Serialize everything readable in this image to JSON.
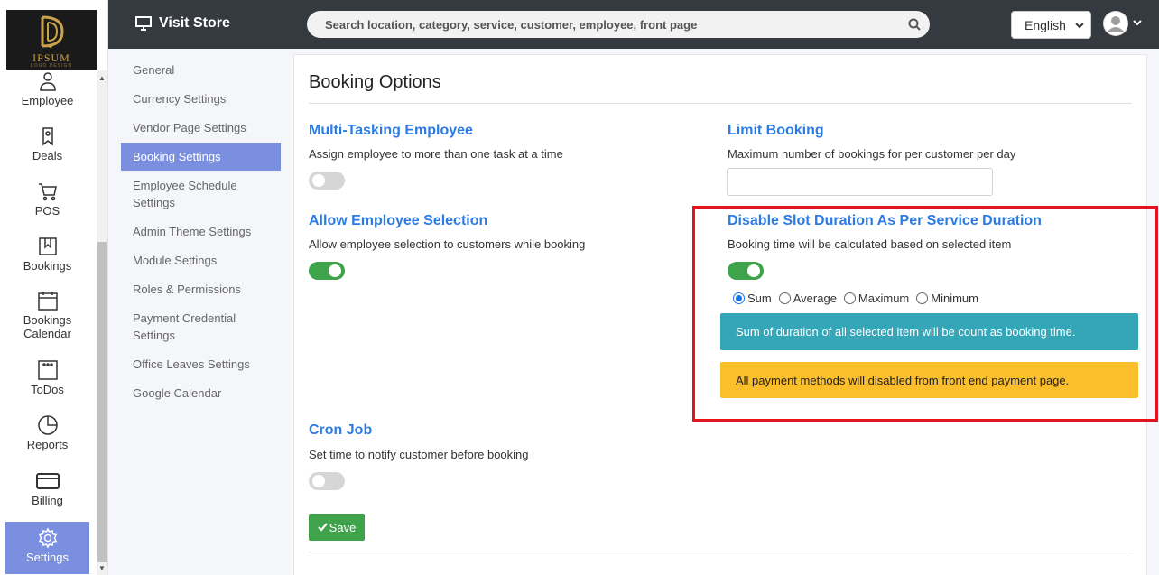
{
  "logo": {
    "brand": "IPSUM",
    "tagline": "LOGO DESIGN"
  },
  "rail": {
    "items": [
      {
        "label": "Employee",
        "icon": "employee-icon"
      },
      {
        "label": "Deals",
        "icon": "deals-icon"
      },
      {
        "label": "POS",
        "icon": "cart-icon"
      },
      {
        "label": "Bookings",
        "icon": "bookings-icon"
      },
      {
        "label": "Bookings Calendar",
        "icon": "calendar-icon"
      },
      {
        "label": "ToDos",
        "icon": "todos-icon"
      },
      {
        "label": "Reports",
        "icon": "pie-chart-icon"
      },
      {
        "label": "Billing",
        "icon": "credit-card-icon"
      },
      {
        "label": "Settings",
        "icon": "gear-icon",
        "active": true
      }
    ]
  },
  "topbar": {
    "visit_store": "Visit Store",
    "search_placeholder": "Search location, category, service, customer, employee, front page",
    "language": "English"
  },
  "submenu": {
    "items": [
      {
        "label": "General"
      },
      {
        "label": "Currency Settings"
      },
      {
        "label": "Vendor Page Settings"
      },
      {
        "label": "Booking Settings",
        "active": true
      },
      {
        "label": "Employee Schedule Settings"
      },
      {
        "label": "Admin Theme Settings"
      },
      {
        "label": "Module Settings"
      },
      {
        "label": "Roles & Permissions"
      },
      {
        "label": "Payment Credential Settings"
      },
      {
        "label": "Office Leaves Settings"
      },
      {
        "label": "Google Calendar"
      }
    ]
  },
  "main": {
    "title": "Booking Options",
    "multitask": {
      "title": "Multi-Tasking Employee",
      "desc": "Assign employee to more than one task at a time",
      "enabled": false
    },
    "limit": {
      "title": "Limit Booking",
      "desc": "Maximum number of bookings for per customer per day",
      "value": ""
    },
    "allow_selection": {
      "title": "Allow Employee Selection",
      "desc": "Allow employee selection to customers while booking",
      "enabled": true
    },
    "slot_duration": {
      "title": "Disable Slot Duration As Per Service Duration",
      "desc": "Booking time will be calculated based on selected item",
      "enabled": true,
      "options": [
        "Sum",
        "Average",
        "Maximum",
        "Minimum"
      ],
      "selected": "Sum",
      "info": "Sum of duration of all selected item will be count as booking time.",
      "warning": "All payment methods will disabled from front end payment page."
    },
    "cron": {
      "title": "Cron Job",
      "desc": "Set time to notify customer before booking",
      "enabled": false
    },
    "save_label": "Save"
  },
  "colors": {
    "accent": "#2c7be5",
    "active_menu": "#7b8fe0",
    "toggle_on": "#3ea34a",
    "info": "#35a5b8",
    "warning": "#fbbf2c",
    "highlight": "#e3141a"
  }
}
